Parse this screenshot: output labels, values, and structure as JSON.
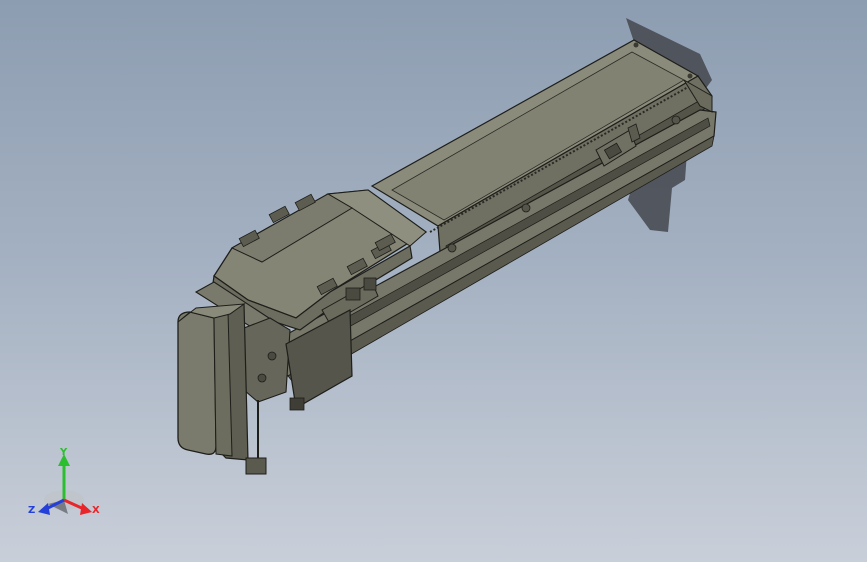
{
  "triad": {
    "x_label": "X",
    "y_label": "Y",
    "z_label": "Z",
    "x_color": "#e8252b",
    "y_color": "#2bbf2f",
    "z_color": "#2440d8"
  },
  "colors": {
    "body_top": "#8a8a7a",
    "body_side": "#6e6e60",
    "body_dark": "#4d4d44",
    "edge": "#1e1e1a",
    "background_top": "#8d9db1",
    "background_bottom": "#c9cfd9"
  }
}
